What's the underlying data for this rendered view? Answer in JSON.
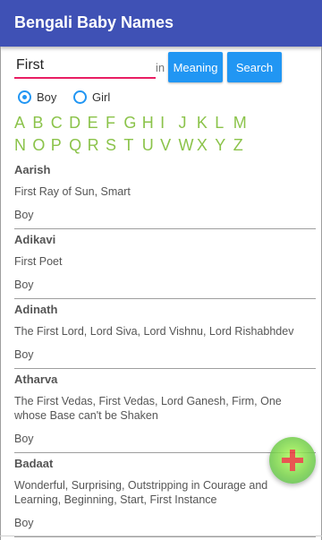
{
  "app": {
    "title": "Bengali Baby Names"
  },
  "search": {
    "value": "First",
    "in_label": "in",
    "meaning_button": "Meaning",
    "search_button": "Search"
  },
  "gender_filter": {
    "options": [
      {
        "label": "Boy",
        "checked": true
      },
      {
        "label": "Girl",
        "checked": false
      }
    ]
  },
  "alphabet": {
    "row1": [
      "A",
      "B",
      "C",
      "D",
      "E",
      "F",
      "G",
      "H",
      "I",
      "J",
      "K",
      "L",
      "M"
    ],
    "row2": [
      "N",
      "O",
      "P",
      "Q",
      "R",
      "S",
      "T",
      "U",
      "V",
      "W",
      "X",
      "Y",
      "Z"
    ]
  },
  "names": [
    {
      "name": "Aarish",
      "meaning": "First Ray of Sun, Smart",
      "gender": "Boy"
    },
    {
      "name": "Adikavi",
      "meaning": "First Poet",
      "gender": "Boy"
    },
    {
      "name": "Adinath",
      "meaning": "The First Lord, Lord Siva, Lord Vishnu, Lord Rishabhdev",
      "gender": "Boy"
    },
    {
      "name": "Atharva",
      "meaning": "The First Vedas, First Vedas, Lord Ganesh, Firm, One whose Base can't be Shaken",
      "gender": "Boy"
    },
    {
      "name": "Badaat",
      "meaning": "Wonderful, Surprising, Outstripping in Courage and Learning, Beginning, Start, First Instance",
      "gender": "Boy"
    }
  ],
  "fab": {
    "icon": "add-icon",
    "color": "#8bc34a",
    "plus_color": "#e53935"
  },
  "colors": {
    "appbar": "#3f51b5",
    "button": "#2196f3",
    "accent": "#e91e63",
    "alphabet": "#8bc34a"
  }
}
